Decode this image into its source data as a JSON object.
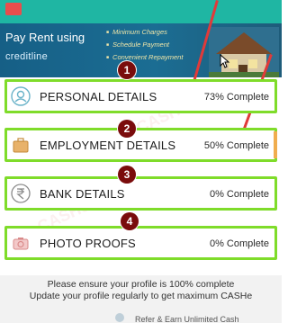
{
  "banner": {
    "title": "Pay Rent using",
    "brand": "creditline",
    "features": [
      "Minimum Charges",
      "Schedule Payment",
      "Convenient Repayment"
    ]
  },
  "sections": [
    {
      "number": "1",
      "label": "PERSONAL DETAILS",
      "status": "73% Complete",
      "icon": "person-icon"
    },
    {
      "number": "2",
      "label": "EMPLOYMENT DETAILS",
      "status": "50% Complete",
      "icon": "briefcase-icon"
    },
    {
      "number": "3",
      "label": "BANK DETAILS",
      "status": "0% Complete",
      "icon": "rupee-icon"
    },
    {
      "number": "4",
      "label": "PHOTO PROOFS",
      "status": "0% Complete",
      "icon": "camera-icon"
    }
  ],
  "footer": {
    "line1": "Please ensure your profile is 100% complete",
    "line2": "Update your profile regularly to get maximum CASHe",
    "partial": "Refer & Earn Unlimited Cash"
  },
  "colors": {
    "highlight_border": "#7fdc2a",
    "badge": "#7a0c0c",
    "banner": "#165f86",
    "top_strip": "#1fb6a3",
    "annotation_red": "#e03a3a"
  }
}
